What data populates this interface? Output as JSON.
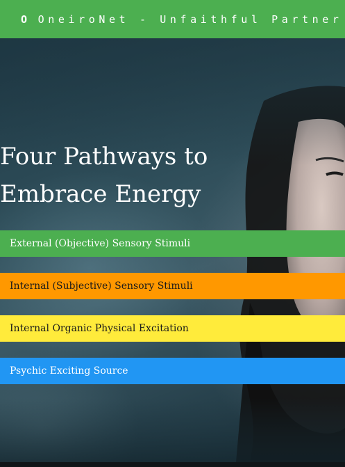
{
  "header": {
    "logo_letter": "O",
    "title": "OneiroNet - Unfaithful Partner",
    "background": "#4caf50"
  },
  "hero": {
    "headline": "Four Pathways to Embrace Energy"
  },
  "pathways": [
    {
      "label": "External (Objective) Sensory Stimuli",
      "color": "#4caf50"
    },
    {
      "label": "Internal (Subjective) Sensory Stimuli",
      "color": "#ff9800"
    },
    {
      "label": "Internal Organic Physical Excitation",
      "color": "#ffeb3b"
    },
    {
      "label": "Psychic Exciting Source",
      "color": "#2196f3"
    }
  ]
}
